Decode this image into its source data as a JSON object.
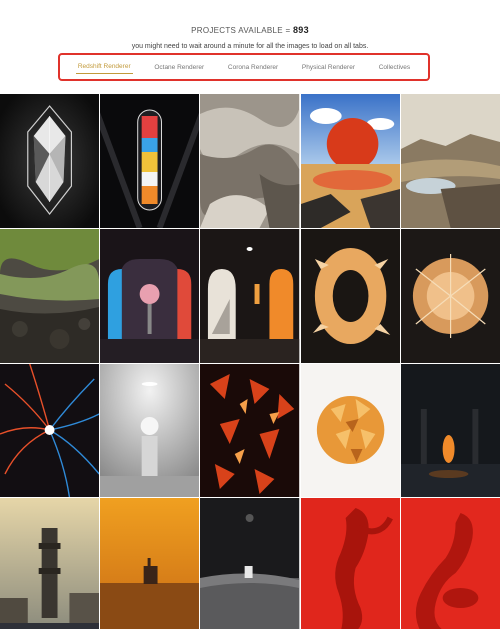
{
  "header": {
    "projects_label": "PROJECTS AVAILABLE =",
    "projects_count": "893",
    "note": "you might need to wait around a minute for all the images to load on all tabs."
  },
  "tabs": [
    {
      "label": "Redshift Renderer",
      "active": true
    },
    {
      "label": "Octane Renderer",
      "active": false
    },
    {
      "label": "Corona Renderer",
      "active": false
    },
    {
      "label": "Physical Renderer",
      "active": false
    },
    {
      "label": "Collectives",
      "active": false
    }
  ],
  "colors": {
    "highlight_border": "#e0322b",
    "active_tab": "#c29a3b"
  },
  "gallery": [
    {
      "subject": "crystal-diamond-dark"
    },
    {
      "subject": "glowing-crystal-capsule"
    },
    {
      "subject": "rocky-canyon-landscape"
    },
    {
      "subject": "red-sphere-sunset-lake"
    },
    {
      "subject": "desert-plateau-pond"
    },
    {
      "subject": "mossy-lava-terrain"
    },
    {
      "subject": "red-arch-orb"
    },
    {
      "subject": "stairs-arch-corridor"
    },
    {
      "subject": "golden-ring-sculpture"
    },
    {
      "subject": "golden-spiky-sphere"
    },
    {
      "subject": "red-blue-energy-burst"
    },
    {
      "subject": "white-room-pedestal"
    },
    {
      "subject": "lava-cracked-shards"
    },
    {
      "subject": "amber-crystal-sphere"
    },
    {
      "subject": "dark-pillars-light"
    },
    {
      "subject": "foggy-industrial-tower"
    },
    {
      "subject": "orange-desert-haze"
    },
    {
      "subject": "dark-lunar-surface"
    },
    {
      "subject": "red-figure-pose"
    },
    {
      "subject": "red-figure-sitting"
    }
  ]
}
